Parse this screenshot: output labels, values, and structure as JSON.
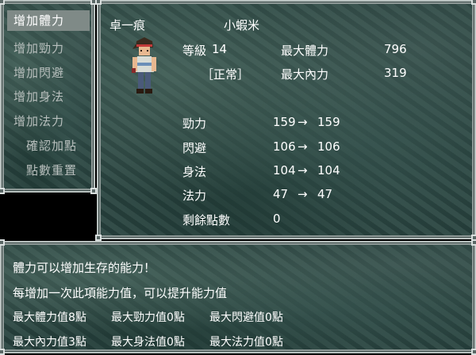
{
  "menu": {
    "items": [
      {
        "label": "增加體力",
        "selected": true
      },
      {
        "label": "增加勁力",
        "selected": false
      },
      {
        "label": "增加閃避",
        "selected": false
      },
      {
        "label": "增加身法",
        "selected": false
      },
      {
        "label": "增加法力",
        "selected": false
      },
      {
        "label": "確認加點",
        "selected": false
      },
      {
        "label": "點數重置",
        "selected": false
      }
    ]
  },
  "character": {
    "name": "卓一痕",
    "nickname": "小蝦米",
    "level_label": "等級",
    "level": "14",
    "status": "［正常］",
    "max_hp_label": "最大體力",
    "max_hp": "796",
    "max_mp_label": "最大內力",
    "max_mp": "319"
  },
  "attributes": [
    {
      "label": "勁力",
      "from": "159",
      "arrow": "→",
      "to": "159"
    },
    {
      "label": "閃避",
      "from": "106",
      "arrow": "→",
      "to": "106"
    },
    {
      "label": "身法",
      "from": "104",
      "arrow": "→",
      "to": "104"
    },
    {
      "label": "法力",
      "from": "47",
      "arrow": "→",
      "to": "47"
    }
  ],
  "remaining": {
    "label": "剩餘點數",
    "value": "0"
  },
  "description": {
    "line1": "體力可以增加生存的能力！",
    "line2": "每增加一次此項能力值，可以提升能力值",
    "bonuses": [
      "最大體力值8點",
      "最大勁力值0點",
      "最大閃避值0點",
      "最大內力值3點",
      "最大身法值0點",
      "最大法力值0點"
    ]
  },
  "colors": {
    "panel_base": "#2d4743",
    "selected_bg": "#7f8a87",
    "border": "#b9c2c0"
  }
}
